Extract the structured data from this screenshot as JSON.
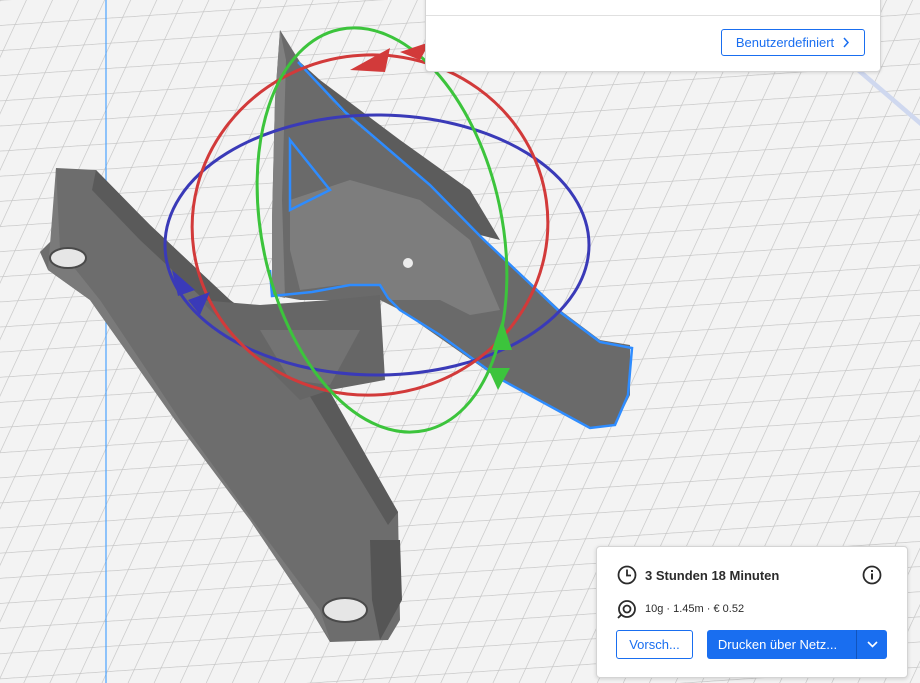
{
  "settings_panel": {
    "custom_button_label": "Benutzerdefiniert",
    "custom_button_icon": "chevron-right-icon"
  },
  "print_panel": {
    "time_icon": "clock-icon",
    "print_time": "3 Stunden 18 Minuten",
    "info_icon": "info-icon",
    "material_icon": "filament-spool-icon",
    "material_info": "10g · 1.45m · € 0.52",
    "preview_label": "Vorsch...",
    "print_label": "Drucken über Netz...",
    "print_dropdown_icon": "chevron-down-icon"
  },
  "colors": {
    "accent": "#196ef0",
    "model": "#6b6b6b",
    "selection_outline": "#2e8cff",
    "rotate_x": "#d23a3a",
    "rotate_y": "#3cc43c",
    "rotate_z": "#3a3ab8",
    "build_plate": "#f3f3f3"
  }
}
